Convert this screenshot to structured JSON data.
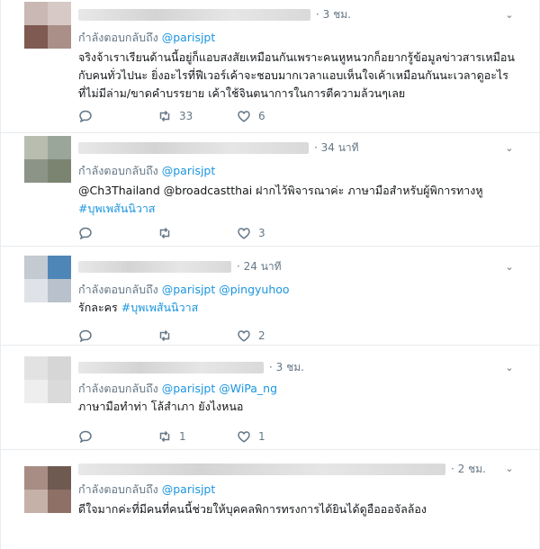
{
  "tweets": [
    {
      "time": "· 3 ชม.",
      "reply_label": "กำลังตอบกลับถึง",
      "mentions": "@parisjpt",
      "text": "จริงจ้าเราเรียนด้านนี้อยู่ก็แอบสงสัยเหมือนกันเพราะคนหูหนวกก็อยากรู้ข้อมูลข่าวสารเหมือนกับคนทั่วไปนะ ยิ่งอะไรที่ฟีเวอร์เค้าจะชอบมากเวลาแอบเห็นใจเค้าเหมือนกันนะเวลาดูอะไร ที่ไม่มีล่าม/ขาดคำบรรยาย เค้าใช้จินตนาการในการตีความล้วนๆเลย",
      "text_link": "",
      "retweets": "33",
      "likes": "6",
      "avatar_colors": [
        "#c9b8b3",
        "#d7c9c6",
        "#7e5a52",
        "#a98f87"
      ]
    },
    {
      "time": "· 34 นาที",
      "reply_label": "กำลังตอบกลับถึง",
      "mentions": "@parisjpt",
      "text": "@Ch3Thailand @broadcastthai  ฝากไว้พิจารณาค่ะ ภาษามือสำหรับผู้พิการทางหู",
      "text_link": "#บุพเพสันนิวาส",
      "retweets": "",
      "likes": "3",
      "avatar_colors": [
        "#b8bdb0",
        "#9aa69a",
        "#8c9487",
        "#7a8470"
      ]
    },
    {
      "time": "· 24 นาที",
      "reply_label": "กำลังตอบกลับถึง",
      "mentions": "@parisjpt @pingyuhoo",
      "text": "รักละคร",
      "text_link": "#บุพเพสันนิวาส",
      "retweets": "",
      "likes": "2",
      "avatar_colors": [
        "#c4cad2",
        "#4f86b8",
        "#dfe3e8",
        "#b9c2cc"
      ]
    },
    {
      "time": "· 3 ชม.",
      "reply_label": "กำลังตอบกลับถึง",
      "mentions": "@parisjpt @WiPa_ng",
      "text": "ภาษามือทำท่า โล้สำเภา ยังไงหนอ",
      "text_link": "",
      "retweets": "1",
      "likes": "1",
      "avatar_colors": [
        "#e2e2e2",
        "#d6d6d6",
        "#eeeeee",
        "#dadada"
      ]
    },
    {
      "time": "· 2 ชม.",
      "reply_label": "กำลังตอบกลับถึง",
      "mentions": "@parisjpt",
      "text": "ดีใจมากค่ะที่มีคนที่คนนี้ช่วยให้บุคคลพิการทรงการได้ยินได้ดูอือออจัลล้อง",
      "text_link": "",
      "retweets": "",
      "likes": "",
      "avatar_colors": [
        "#a78d84",
        "#6f5a52",
        "#c5b1a8",
        "#8f7066"
      ]
    }
  ]
}
